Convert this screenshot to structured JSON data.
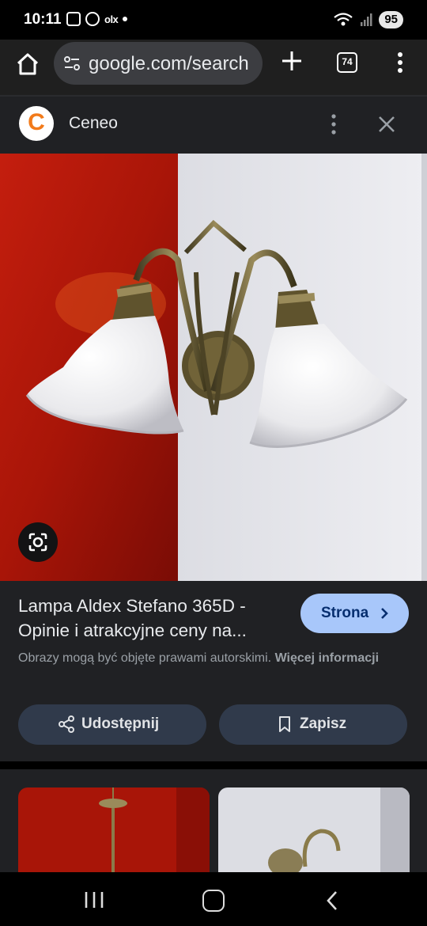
{
  "status_bar": {
    "time": "10:11",
    "notification_app": "olx",
    "battery": "95"
  },
  "browser": {
    "url": "google.com/search",
    "tab_count": "74",
    "icons": [
      "home-icon",
      "site-settings-icon",
      "new-tab-icon",
      "tab-switcher-icon",
      "overflow-menu-icon"
    ]
  },
  "source": {
    "logo_letter": "C",
    "name": "Ceneo"
  },
  "result": {
    "title": "Lampa Aldex Stefano 365D - Opinie i atrakcyjne ceny na...",
    "visit_label": "Strona",
    "copyright_text": "Obrazy mogą być objęte prawami autorskimi.",
    "more_info_label": "Więcej informacji",
    "share_label": "Udostępnij",
    "save_label": "Zapisz"
  },
  "colors": {
    "panel_bg": "#202124",
    "visit_button": "#a8c7fa",
    "action_button": "#303a4b",
    "brand_orange": "#f27a1a"
  }
}
